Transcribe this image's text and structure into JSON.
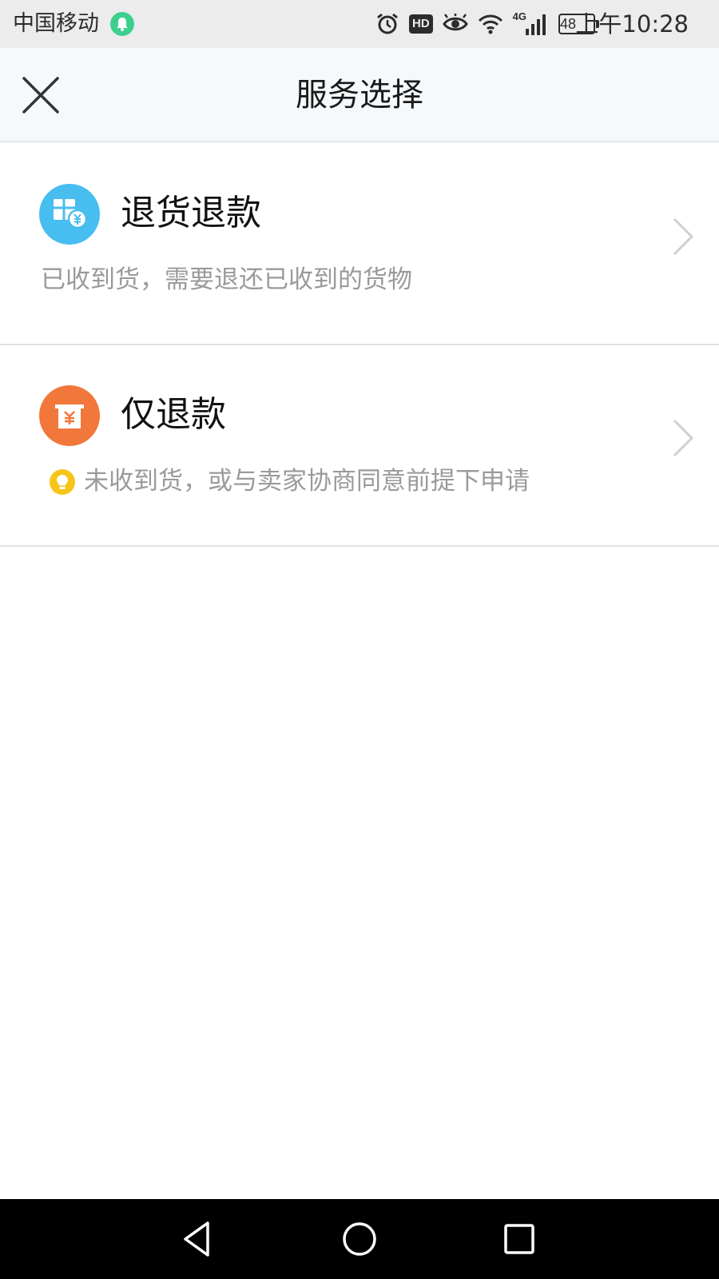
{
  "status_bar": {
    "carrier": "中国移动",
    "network": "4G",
    "battery": "48",
    "time": "上午10:28",
    "icons": [
      "notification-bell-icon",
      "alarm-icon",
      "hd-icon",
      "eye-icon",
      "wifi-icon",
      "signal-icon",
      "battery-icon"
    ]
  },
  "header": {
    "title": "服务选择",
    "close_icon": "close-icon"
  },
  "options": [
    {
      "title": "退货退款",
      "description": "已收到货，需要退还已收到的货物",
      "icon": "package-yuan-icon",
      "icon_color": "#47bdf0"
    },
    {
      "title": "仅退款",
      "description": "未收到货，或与卖家协商同意前提下申请",
      "icon": "cash-register-yuan-icon",
      "icon_color": "#f2773a",
      "tip_icon": "lightbulb-icon",
      "tip_color": "#f5c518"
    }
  ],
  "nav_bar": {
    "back_icon": "back-triangle-icon",
    "home_icon": "home-circle-icon",
    "recent_icon": "recent-apps-square-icon"
  }
}
